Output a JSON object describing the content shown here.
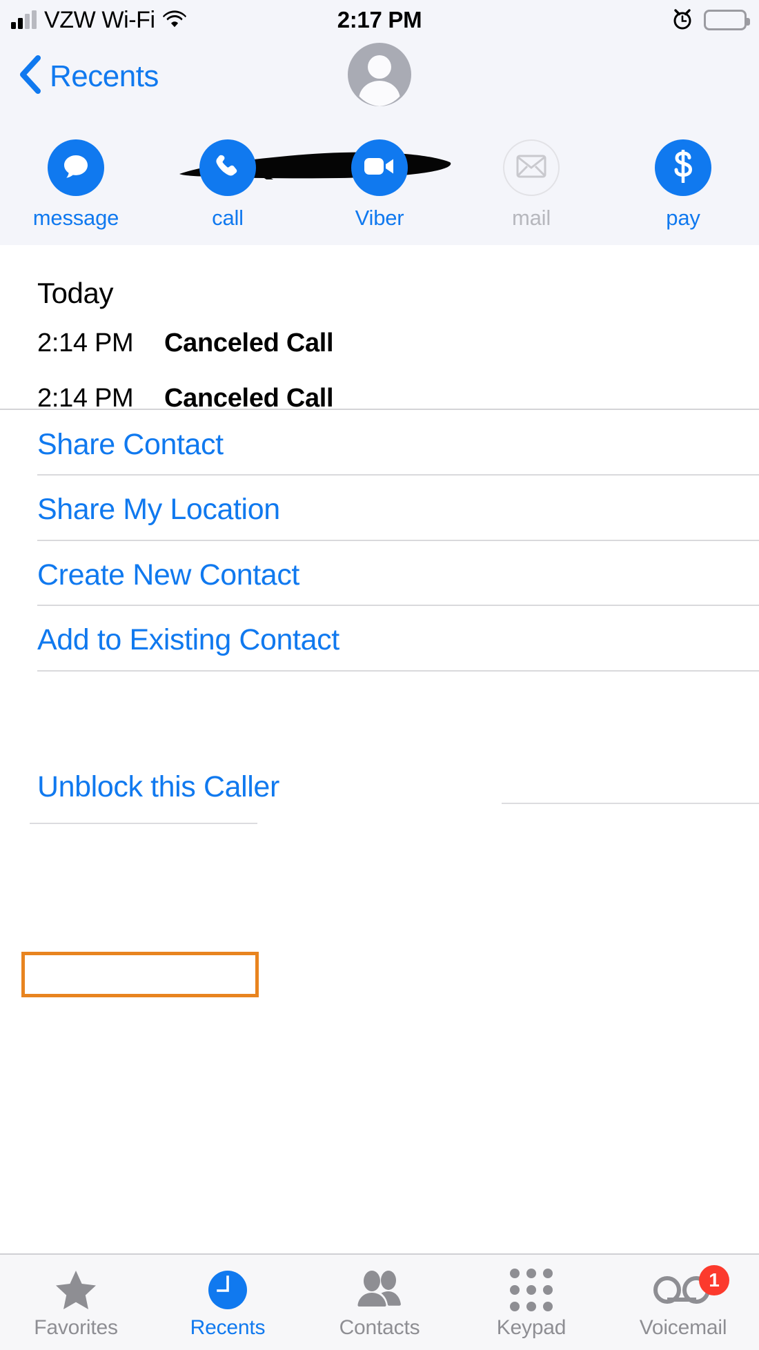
{
  "status_bar": {
    "carrier": "VZW Wi-Fi",
    "time": "2:17 PM",
    "signal_icon": "signal-bars-icon",
    "wifi_icon": "wifi-icon",
    "alarm_icon": "alarm-clock-icon",
    "battery_icon": "battery-icon"
  },
  "header": {
    "back_label": "Recents",
    "back_icon": "chevron-left-icon",
    "avatar_icon": "person-placeholder-avatar",
    "contact_name_redacted": true,
    "actions": [
      {
        "label": "message",
        "icon": "message-bubble-icon",
        "disabled": false
      },
      {
        "label": "call",
        "icon": "phone-icon",
        "disabled": false
      },
      {
        "label": "Viber",
        "icon": "video-camera-icon",
        "disabled": false
      },
      {
        "label": "mail",
        "icon": "envelope-icon",
        "disabled": true
      },
      {
        "label": "pay",
        "icon": "dollar-sign-icon",
        "disabled": false
      }
    ]
  },
  "call_log": {
    "section_title": "Today",
    "entries": [
      {
        "time": "2:14 PM",
        "type": "Canceled Call"
      },
      {
        "time": "2:14 PM",
        "type": "Canceled Call"
      }
    ]
  },
  "contact_actions": [
    {
      "label": "Share Contact"
    },
    {
      "label": "Share My Location"
    },
    {
      "label": "Create New Contact"
    },
    {
      "label": "Add to Existing Contact"
    }
  ],
  "block_action": {
    "label": "Unblock this Caller",
    "highlighted": true,
    "highlight_color": "#e8841f"
  },
  "tab_bar": {
    "items": [
      {
        "label": "Favorites",
        "icon": "star-icon",
        "active": false,
        "badge": null
      },
      {
        "label": "Recents",
        "icon": "clock-icon",
        "active": true,
        "badge": null
      },
      {
        "label": "Contacts",
        "icon": "people-icon",
        "active": false,
        "badge": null
      },
      {
        "label": "Keypad",
        "icon": "keypad-dots-icon",
        "active": false,
        "badge": null
      },
      {
        "label": "Voicemail",
        "icon": "voicemail-tape-icon",
        "active": false,
        "badge": "1"
      }
    ]
  },
  "colors": {
    "accent_blue": "#1079ef",
    "badge_red": "#fc3a2d",
    "highlight_orange": "#e8841f",
    "header_bg": "#f4f5fa"
  }
}
